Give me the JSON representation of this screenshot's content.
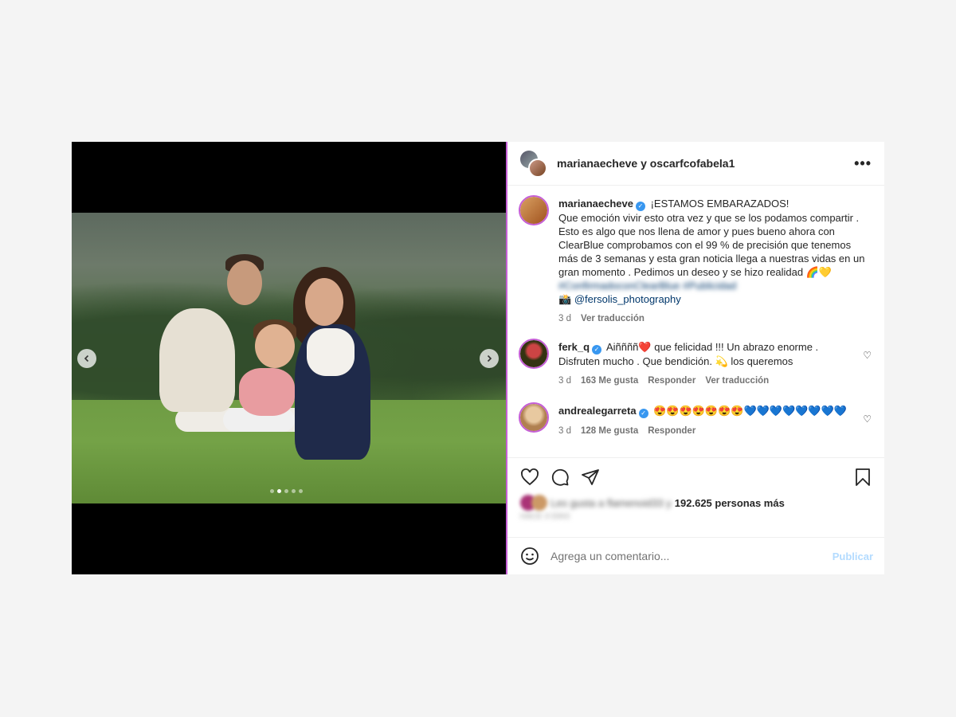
{
  "header": {
    "names": "marianaecheve y oscarfcofabela1",
    "more": "•••"
  },
  "media": {
    "dots": 5,
    "active_dot": 1
  },
  "caption": {
    "user": "marianaecheve",
    "title": "¡ESTAMOS EMBARAZADOS!",
    "text": "Que emoción vivir esto otra vez y que se los podamos compartir . Esto es algo que nos llena de amor y pues bueno ahora con ClearBlue comprobamos con el 99 % de precisión que tenemos más de 3 semanas y esta gran noticia llega a nuestras vidas en un gran momento . Pedimos un deseo y se hizo realidad 🌈💛",
    "hashtags": "#ConfirmadoconClearBlue #Publicidad",
    "credit_prefix": "📸 ",
    "credit": "@fersolis_photography",
    "time": "3 d",
    "translate": "Ver traducción"
  },
  "comments": [
    {
      "user": "ferk_q",
      "text": "Aiññññ❤️ que felicidad !!! Un abrazo enorme . Disfruten mucho . Que bendición. 💫 los queremos",
      "time": "3 d",
      "likes": "163 Me gusta",
      "reply": "Responder",
      "translate": "Ver traducción"
    },
    {
      "user": "andrealegarreta",
      "text": "😍😍😍😍😍😍😍💙💙💙💙💙💙💙💙",
      "time": "3 d",
      "likes": "128 Me gusta",
      "reply": "Responder"
    }
  ],
  "likes": {
    "blurred": "Les gusta a flamenoid33 y",
    "count": "192.625 personas más",
    "date": "HACE 3 DÍAS"
  },
  "add_comment": {
    "placeholder": "Agrega un comentario...",
    "publish": "Publicar"
  }
}
